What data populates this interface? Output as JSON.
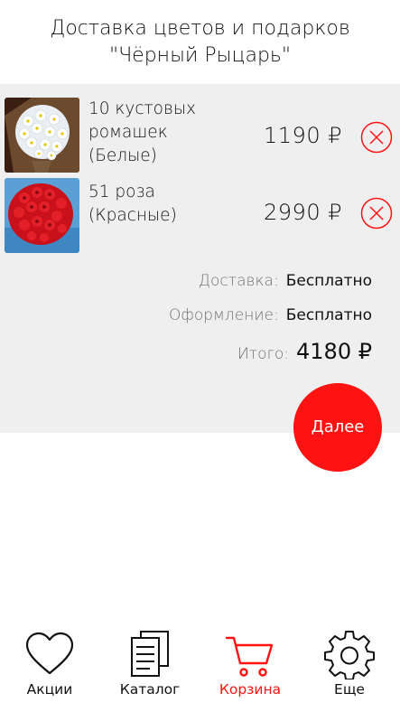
{
  "header": {
    "line1": "Доставка цветов и подарков",
    "line2": "\"Чёрный Рыцарь\""
  },
  "cart": {
    "items": [
      {
        "name": "10 кустовых ромашек (Белые)",
        "price": "1190 ₽",
        "image": "white-daisies-bouquet",
        "remove_icon": "close-circle-icon"
      },
      {
        "name": "51 роза (Красные)",
        "price": "2990 ₽",
        "image": "red-roses-bouquet",
        "remove_icon": "close-circle-icon"
      }
    ],
    "delivery_label": "Доставка:",
    "delivery_value": "Бесплатно",
    "packaging_label": "Оформление:",
    "packaging_value": "Бесплатно",
    "total_label": "Итого:",
    "total_value": "4180 ₽",
    "next_label": "Далее"
  },
  "tabbar": {
    "tabs": [
      {
        "label": "Акции",
        "icon": "heart-icon",
        "active": false
      },
      {
        "label": "Каталог",
        "icon": "catalog-icon",
        "active": false
      },
      {
        "label": "Корзина",
        "icon": "cart-icon",
        "active": true
      },
      {
        "label": "Еще",
        "icon": "gear-icon",
        "active": false
      }
    ]
  },
  "colors": {
    "accent": "#ff1212",
    "panel_bg": "#efefef",
    "muted_text": "#707070"
  }
}
